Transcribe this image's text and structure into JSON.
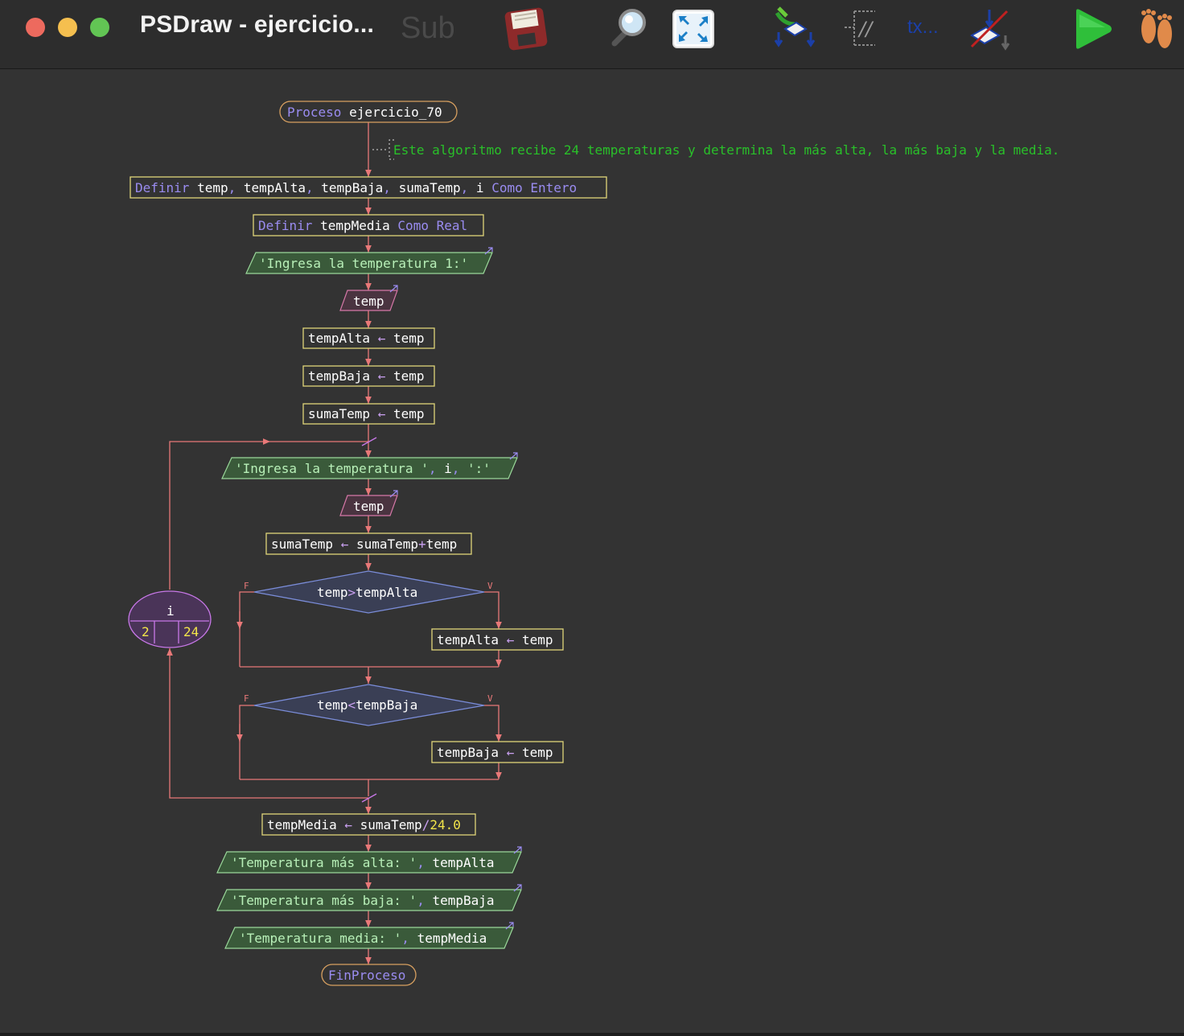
{
  "window": {
    "title": "PSDraw - ejercicio...",
    "ghost_label": "Sub",
    "traffic_colors": {
      "close": "#ed6a5e",
      "minimize": "#f5bf4f",
      "maximize": "#62c554"
    }
  },
  "toolbar": {
    "icons": [
      "save-icon",
      "zoom-icon",
      "fit-screen-icon",
      "auto-layout-icon",
      "comments-toggle-icon",
      "text-icon",
      "cross-out-icon",
      "run-icon",
      "step-icon"
    ],
    "text_button_label": "tx..."
  },
  "flowchart": {
    "proceso_kw": "Proceso",
    "proceso_name": "ejercicio_70",
    "comment": "Este algoritmo recibe 24 temperaturas y determina la más alta, la más baja y la media.",
    "definir1": {
      "kw": "Definir",
      "vars": [
        "temp",
        "tempAlta",
        "tempBaja",
        "sumaTemp",
        "i"
      ],
      "como": "Como",
      "type": "Entero"
    },
    "definir2": {
      "kw": "Definir",
      "var": "tempMedia",
      "como": "Como",
      "type": "Real"
    },
    "out1": "'Ingresa la temperatura 1:'",
    "read1": "temp",
    "assign_alta": {
      "target": "tempAlta",
      "arrow": "←",
      "value": "temp"
    },
    "assign_baja": {
      "target": "tempBaja",
      "arrow": "←",
      "value": "temp"
    },
    "assign_suma": {
      "target": "sumaTemp",
      "arrow": "←",
      "value": "temp"
    },
    "loop": {
      "var": "i",
      "from": "2",
      "to": "24",
      "out_str1": "'Ingresa la temperatura '",
      "out_var": "i",
      "out_str2": "':'",
      "read": "temp",
      "acc": {
        "target": "sumaTemp",
        "arrow": "←",
        "lhs": "sumaTemp",
        "op": "+",
        "rhs": "temp"
      },
      "cond1": {
        "left": "temp",
        "op": ">",
        "right": "tempAlta",
        "then": {
          "target": "tempAlta",
          "arrow": "←",
          "value": "temp"
        }
      },
      "cond2": {
        "left": "temp",
        "op": "<",
        "right": "tempBaja",
        "then": {
          "target": "tempBaja",
          "arrow": "←",
          "value": "temp"
        }
      },
      "false_label": "F",
      "true_label": "V"
    },
    "media": {
      "target": "tempMedia",
      "arrow": "←",
      "lhs": "sumaTemp",
      "op": "/",
      "num": "24.0"
    },
    "out_alta": {
      "str": "'Temperatura más alta: '",
      "var": "tempAlta"
    },
    "out_baja": {
      "str": "'Temperatura más baja: '",
      "var": "tempBaja"
    },
    "out_media": {
      "str": "'Temperatura media: '",
      "var": "tempMedia"
    },
    "fin": "FinProceso"
  },
  "colors": {
    "arrow": "#e87878",
    "box_border": "#e0d67a",
    "io_fill": "#3a5a3a",
    "read_fill": "#4a3440",
    "read_border": "#d678a8",
    "diamond_border": "#7a8cd8",
    "loop_border": "#c878e8",
    "terminal_border": "#d8a060",
    "comment": "#29c029"
  }
}
